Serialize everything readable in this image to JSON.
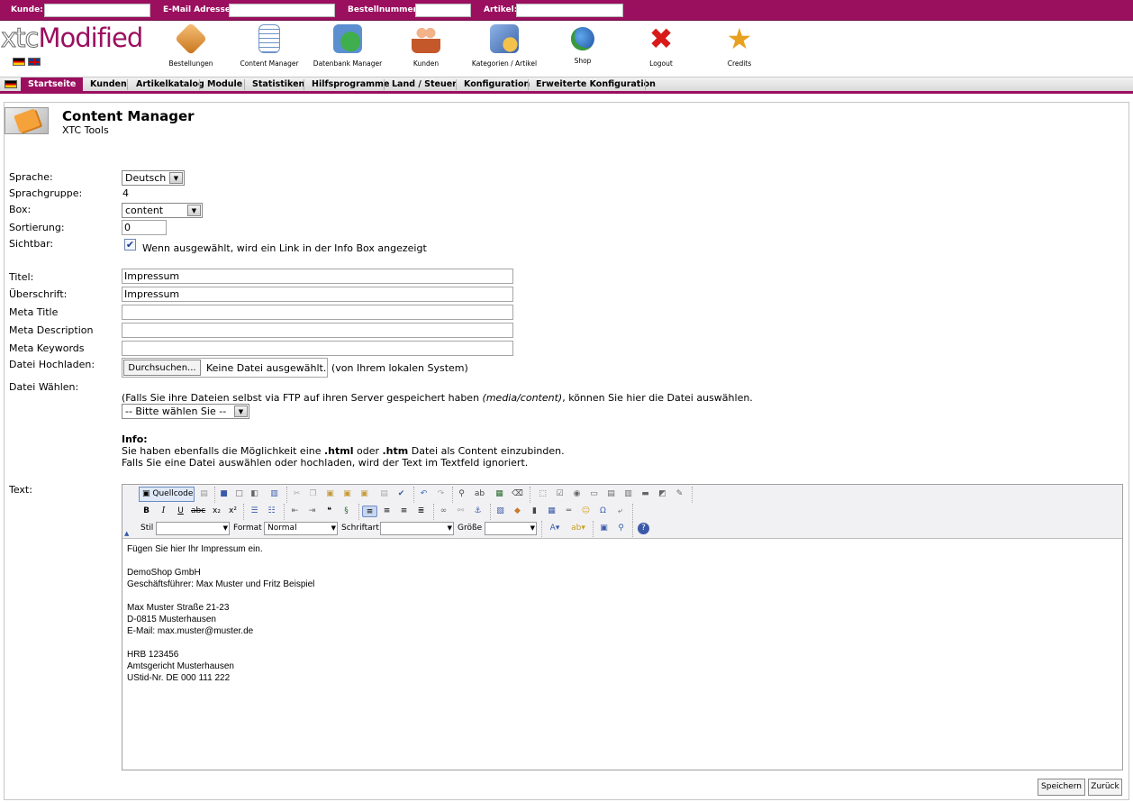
{
  "topbar": {
    "customer_label": "Kunde:",
    "email_label": "E-Mail Adresse:",
    "order_label": "Bestellnummer:",
    "article_label": "Artikel:"
  },
  "logo": {
    "prefix": "xtc",
    "brand": "Modified"
  },
  "header_icons": [
    {
      "label": "Bestellungen",
      "icon": "package-icon",
      "color": "#e6953a"
    },
    {
      "label": "Content Manager",
      "icon": "document-icon",
      "color": "#5b86c2"
    },
    {
      "label": "Datenbank Manager",
      "icon": "database-icon",
      "color": "#2f8a3a"
    },
    {
      "label": "Kunden",
      "icon": "users-icon",
      "color": "#c45a2a"
    },
    {
      "label": "Kategorien / Artikel",
      "icon": "categories-icon",
      "color": "#4a79c0"
    },
    {
      "label": "Shop",
      "icon": "globe-icon",
      "color": "#1f6fc0"
    },
    {
      "label": "Logout",
      "icon": "close-icon",
      "color": "#d81a1a"
    },
    {
      "label": "Credits",
      "icon": "star-icon",
      "color": "#e8a020"
    }
  ],
  "nav": [
    {
      "label": "Startseite",
      "active": true
    },
    {
      "label": "Kunden"
    },
    {
      "label": "Artikelkatalog"
    },
    {
      "label": "Module"
    },
    {
      "label": "Statistiken"
    },
    {
      "label": "Hilfsprogramme"
    },
    {
      "label": "Land / Steuer"
    },
    {
      "label": "Konfiguration"
    },
    {
      "label": "Erweiterte Konfiguration"
    }
  ],
  "page": {
    "title": "Content Manager",
    "subtitle": "XTC Tools"
  },
  "form": {
    "language_label": "Sprache:",
    "language_value": "Deutsch",
    "langgroup_label": "Sprachgruppe:",
    "langgroup_value": "4",
    "box_label": "Box:",
    "box_value": "content",
    "sort_label": "Sortierung:",
    "sort_value": "0",
    "visible_label": "Sichtbar:",
    "visible_text": "Wenn ausgewählt, wird ein Link in der Info Box angezeigt",
    "visible_checked": true,
    "title_label": "Titel:",
    "title_value": "Impressum",
    "heading_label": "Überschrift:",
    "heading_value": "Impressum",
    "meta_title_label": "Meta Title",
    "meta_title_value": "",
    "meta_desc_label": "Meta Description",
    "meta_desc_value": "",
    "meta_keywords_label": "Meta Keywords",
    "meta_keywords_value": "",
    "upload_label": "Datei Hochladen:",
    "browse_button": "Durchsuchen...",
    "no_file": "Keine Datei ausgewählt.",
    "upload_hint": "(von Ihrem lokalen System)",
    "choose_label": "Datei Wählen:",
    "choose_hint_pre": "(Falls Sie ihre Dateien selbst via FTP auf ihren Server gespeichert haben ",
    "choose_hint_path": "(media/content)",
    "choose_hint_post": ", können Sie hier die Datei auswählen.",
    "choose_select": "-- Bitte wählen Sie --",
    "info_heading": "Info:",
    "info_line1_a": "Sie haben ebenfalls die Möglichkeit eine ",
    "info_line1_html": ".html",
    "info_line1_b": " oder ",
    "info_line1_htm": ".htm",
    "info_line1_c": " Datei als Content einzubinden.",
    "info_line2": "Falls Sie eine Datei auswählen oder hochladen, wird der Text im Textfeld ignoriert.",
    "text_label": "Text:"
  },
  "editor": {
    "source_button": "Quellcode",
    "style_label": "Stil",
    "format_label": "Format",
    "format_value": "Normal",
    "font_label": "Schriftart",
    "size_label": "Größe",
    "lines": [
      "Fügen Sie hier Ihr Impressum ein.",
      "",
      "DemoShop GmbH",
      "Geschäftsführer: Max Muster und Fritz Beispiel",
      "",
      "Max Muster Straße 21-23",
      "D-0815 Musterhausen",
      "E-Mail: max.muster@muster.de",
      "",
      "HRB 123456",
      "Amtsgericht Musterhausen",
      "UStid-Nr. DE 000 111 222"
    ]
  },
  "actions": {
    "save": "Speichern",
    "back": "Zurück"
  }
}
